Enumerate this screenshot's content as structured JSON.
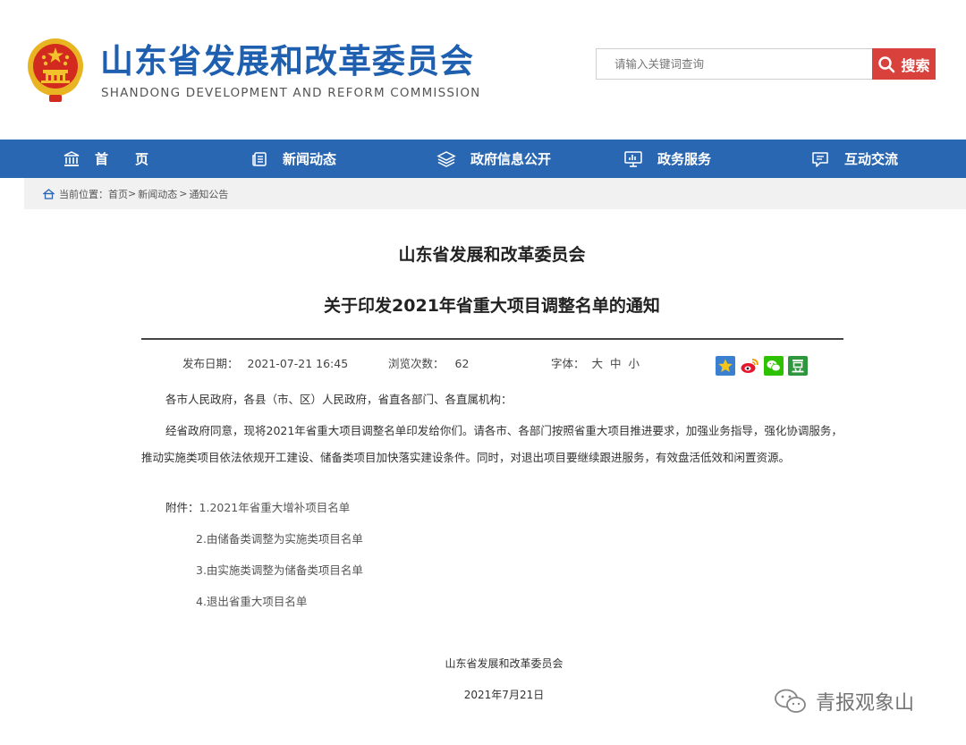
{
  "header": {
    "site_title": "山东省发展和改革委员会",
    "site_subtitle": "SHANDONG DEVELOPMENT AND REFORM COMMISSION",
    "search_placeholder": "请输入关键词查询",
    "search_button": "搜索"
  },
  "nav": {
    "items": [
      {
        "label": "首　　页",
        "icon": "building-icon"
      },
      {
        "label": "新闻动态",
        "icon": "news-icon"
      },
      {
        "label": "政府信息公开",
        "icon": "layers-icon"
      },
      {
        "label": "政务服务",
        "icon": "monitor-icon"
      },
      {
        "label": "互动交流",
        "icon": "chat-icon"
      }
    ]
  },
  "breadcrumb": {
    "prefix": "当前位置：",
    "items": [
      "首页",
      "新闻动态",
      "通知公告"
    ],
    "separator": ">"
  },
  "article": {
    "title_line1": "山东省发展和改革委员会",
    "title_line2": "关于印发2021年省重大项目调整名单的通知",
    "meta": {
      "publish_label": "发布日期：",
      "publish_value": "2021-07-21 16:45",
      "views_label": "浏览次数：",
      "views_value": "62",
      "font_label": "字体：",
      "font_large": "大",
      "font_medium": "中",
      "font_small": "小"
    },
    "salutation": "各市人民政府，各县（市、区）人民政府，省直各部门、各直属机构：",
    "body": "经省政府同意，现将2021年省重大项目调整名单印发给你们。请各市、各部门按照省重大项目推进要求，加强业务指导，强化协调服务，推动实施类项目依法依规开工建设、储备类项目加快落实建设条件。同时，对退出项目要继续跟进服务，有效盘活低效和闲置资源。",
    "attachments_label": "附件：",
    "attachments": [
      "1.2021年省重大增补项目名单",
      "2.由储备类调整为实施类项目名单",
      "3.由实施类调整为储备类项目名单",
      "4.退出省重大项目名单"
    ],
    "signature": "山东省发展和改革委员会",
    "date": "2021年7月21日"
  },
  "watermark": "青报观象山",
  "colors": {
    "brand_blue": "#1e5fb0",
    "nav_blue": "#2a67b3",
    "search_red": "#d9423c"
  }
}
